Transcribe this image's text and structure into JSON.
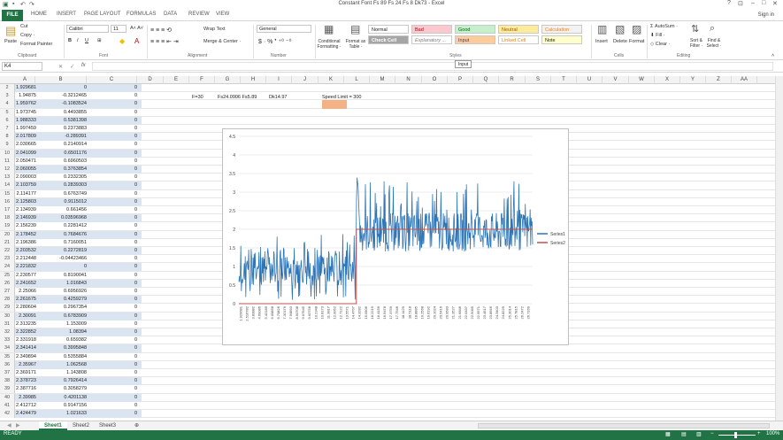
{
  "window": {
    "title": "Constant Font Fs 89 Fs 24 Fs 8 Dk73 - Excel",
    "signin": "Sign in",
    "min": "–",
    "max": "□",
    "close": "✕",
    "help": "?"
  },
  "tabs": [
    "FILE",
    "HOME",
    "INSERT",
    "PAGE LAYOUT",
    "FORMULAS",
    "DATA",
    "REVIEW",
    "VIEW"
  ],
  "ribbon": {
    "clipboard": {
      "paste": "Paste",
      "cut": "Cut",
      "copy": "Copy ·",
      "format_painter": "Format Painter",
      "label": "Clipboard"
    },
    "font": {
      "name": "Calibri",
      "size": "11",
      "label": "Font"
    },
    "alignment": {
      "wrap": "Wrap Text",
      "merge": "Merge & Center ·",
      "label": "Alignment"
    },
    "number": {
      "format": "General",
      "label": "Number"
    },
    "styles": {
      "conditional": "Conditional Formatting ·",
      "format_table": "Format as Table ·",
      "normal": "Normal",
      "bad": "Bad",
      "good": "Good",
      "neutral": "Neutral",
      "calculation": "Calculation",
      "check_cell": "Check Cell",
      "explanatory": "Explanatory ...",
      "input": "Input",
      "linked_cell": "Linked Cell",
      "note": "Note",
      "label": "Styles"
    },
    "cells": {
      "insert": "Insert",
      "delete": "Delete",
      "format": "Format",
      "label": "Cells"
    },
    "editing": {
      "autosum": "AutoSum ·",
      "fill": "Fill ·",
      "clear": "Clear ·",
      "sort": "Sort & Filter ·",
      "find": "Find & Select ·",
      "label": "Editing"
    }
  },
  "formula_bar": {
    "namebox": "K4",
    "fx": "fx",
    "tooltip": "Input"
  },
  "columns": [
    "A",
    "B",
    "C",
    "D",
    "E",
    "F",
    "G",
    "H",
    "I",
    "J",
    "K",
    "L",
    "M",
    "N",
    "O",
    "P",
    "Q",
    "R",
    "S",
    "T",
    "U",
    "V",
    "W",
    "X",
    "Y",
    "Z",
    "AA"
  ],
  "rows": [
    {
      "n": "2",
      "a": "1.929681",
      "b": "0",
      "c": "0"
    },
    {
      "n": "3",
      "a": "1.94875",
      "b": "-0.3212465",
      "c": "0"
    },
    {
      "n": "4",
      "a": "1.959762",
      "b": "-0.1083524",
      "c": "0"
    },
    {
      "n": "5",
      "a": "1.973745",
      "b": "0.4493855",
      "c": "0"
    },
    {
      "n": "6",
      "a": "1.988333",
      "b": "0.5381398",
      "c": "0"
    },
    {
      "n": "7",
      "a": "1.997459",
      "b": "0.2373883",
      "c": "0"
    },
    {
      "n": "8",
      "a": "2.017809",
      "b": "-0.289391",
      "c": "0"
    },
    {
      "n": "9",
      "a": "2.030665",
      "b": "0.2140914",
      "c": "0"
    },
    {
      "n": "10",
      "a": "2.041099",
      "b": "0.6501176",
      "c": "0"
    },
    {
      "n": "11",
      "a": "2.050471",
      "b": "0.6960503",
      "c": "0"
    },
    {
      "n": "12",
      "a": "2.060055",
      "b": "0.3763854",
      "c": "0"
    },
    {
      "n": "13",
      "a": "2.090003",
      "b": "0.2332305",
      "c": "0"
    },
    {
      "n": "14",
      "a": "2.103759",
      "b": "0.2839303",
      "c": "0"
    },
    {
      "n": "15",
      "a": "2.114177",
      "b": "0.6763749",
      "c": "0"
    },
    {
      "n": "16",
      "a": "2.125803",
      "b": "0.9115012",
      "c": "0"
    },
    {
      "n": "17",
      "a": "2.134939",
      "b": "0.661456",
      "c": "0"
    },
    {
      "n": "18",
      "a": "2.146939",
      "b": "0.03596968",
      "c": "0"
    },
    {
      "n": "19",
      "a": "2.156239",
      "b": "0.2281412",
      "c": "0"
    },
    {
      "n": "20",
      "a": "2.178452",
      "b": "0.7684676",
      "c": "0"
    },
    {
      "n": "21",
      "b": "0.7160051",
      "a": "2.196386",
      "c": "0"
    },
    {
      "n": "22",
      "a": "2.203532",
      "b": "0.2272819",
      "c": "0"
    },
    {
      "n": "23",
      "a": "2.212448",
      "b": "-0.04423466",
      "c": "0"
    },
    {
      "n": "24",
      "a": "2.221832",
      "b": "0",
      "c": "0"
    },
    {
      "n": "25",
      "a": "2.230577",
      "b": "0.8190041",
      "c": "0"
    },
    {
      "n": "26",
      "a": "2.241652",
      "b": "1.016843",
      "c": "0"
    },
    {
      "n": "27",
      "a": "2.25066",
      "b": "0.6956926",
      "c": "0"
    },
    {
      "n": "28",
      "a": "2.261675",
      "b": "0.4259279",
      "c": "0"
    },
    {
      "n": "29",
      "a": "2.280604",
      "b": "0.2967354",
      "c": "0"
    },
    {
      "n": "30",
      "a": "2.30091",
      "b": "0.6783909",
      "c": "0"
    },
    {
      "n": "31",
      "a": "2.313235",
      "b": "1.153009",
      "c": "0"
    },
    {
      "n": "32",
      "a": "2.322852",
      "b": "1.08394",
      "c": "0"
    },
    {
      "n": "33",
      "a": "2.331918",
      "b": "0.659382",
      "c": "0"
    },
    {
      "n": "34",
      "a": "2.341414",
      "b": "0.3995848",
      "c": "0"
    },
    {
      "n": "35",
      "a": "2.349894",
      "b": "0.5355884",
      "c": "0"
    },
    {
      "n": "36",
      "a": "2.35967",
      "b": "1.062568",
      "c": "0"
    },
    {
      "n": "37",
      "a": "2.369171",
      "b": "1.143808",
      "c": "0"
    },
    {
      "n": "38",
      "a": "2.378723",
      "b": "0.7926414",
      "c": "0"
    },
    {
      "n": "39",
      "a": "2.387716",
      "b": "0.3058279",
      "c": "0"
    },
    {
      "n": "40",
      "a": "2.39985",
      "b": "0.4201138",
      "c": "0"
    },
    {
      "n": "41",
      "a": "2.412712",
      "b": "0.9147156",
      "c": "0"
    },
    {
      "n": "42",
      "a": "2.424479",
      "b": "1.021633",
      "c": "0"
    }
  ],
  "notes": {
    "f3": "F=30",
    "g3": "Fs24.0906 Fs5.89",
    "i3": "Dk14.97",
    "k3": "Speed Limit = 300"
  },
  "chart_data": {
    "type": "line",
    "title": "",
    "ylim": [
      0,
      4.5
    ],
    "yticks": [
      "0",
      "0.5",
      "1",
      "1.5",
      "2",
      "2.5",
      "3",
      "3.5",
      "4",
      "4.5"
    ],
    "xtick_labels": [
      "1.929681",
      "2.516782",
      "3.83882",
      "4.69086",
      "5.42189",
      "6.09858",
      "6.70826",
      "7.32176",
      "7.94893",
      "8.50708",
      "9.07945",
      "9.62756",
      "10.2348",
      "10.8173",
      "11.3817",
      "12.0052",
      "12.7122",
      "13.5571",
      "14.4767",
      "14.3282",
      "15.0906",
      "16.2219",
      "16.4156",
      "16.9478",
      "17.3759",
      "17.7546",
      "18.1129",
      "18.5118",
      "18.8885",
      "19.2568",
      "19.6192",
      "20.1024",
      "20.5416",
      "20.9583",
      "21.3527",
      "21.6846",
      "22.0437",
      "22.5095",
      "22.9571",
      "23.4517",
      "23.8956",
      "24.3403",
      "24.8229",
      "25.3014",
      "25.7815",
      "26.2472",
      "26.7169"
    ],
    "series": [
      {
        "name": "Series1",
        "color": "#2e75b6"
      },
      {
        "name": "Series2",
        "color": "#c0504d"
      }
    ],
    "step_at_fraction": 0.4,
    "series2_low": 0,
    "series2_high": 2,
    "series1_low_range": [
      0.5,
      1.5
    ],
    "series1_spike": 4.0,
    "series1_high_range": [
      1.4,
      3.3
    ]
  },
  "sheets": [
    "Sheet1",
    "Sheet2",
    "Sheet3"
  ],
  "status": {
    "ready": "READY",
    "zoom": "100%"
  }
}
